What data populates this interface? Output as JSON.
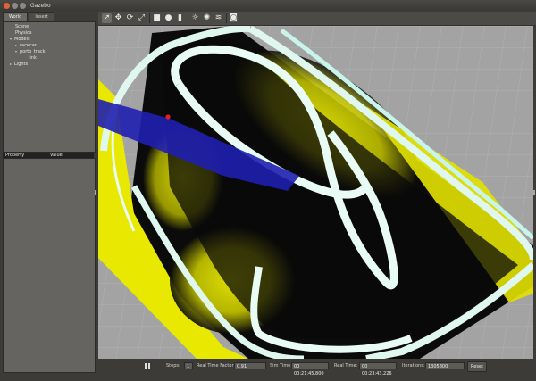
{
  "window": {
    "title": "Gazebo"
  },
  "tabs": [
    {
      "label": "World"
    },
    {
      "label": "Insert"
    }
  ],
  "tree": {
    "scene": "Scene",
    "physics": "Physics",
    "models": "Models",
    "racecar": "racecar",
    "track": "porto_track",
    "link": "link",
    "lights": "Lights"
  },
  "properties": {
    "col_property": "Property",
    "col_value": "Value"
  },
  "toolbar": {
    "icons": [
      "select-arrow-icon",
      "translate-icon",
      "rotate-icon",
      "scale-icon",
      "box-icon",
      "sphere-icon",
      "cylinder-icon",
      "sun-light-icon",
      "point-light-icon",
      "spot-light-icon",
      "camera-icon"
    ]
  },
  "status": {
    "steps_label": "Steps:",
    "steps_value": "1",
    "rtf_label": "Real Time Factor:",
    "rtf_value": "0.91",
    "sim_time_label": "Sim Time:",
    "sim_time_value": "00 00:21:45.800",
    "real_time_label": "Real Time:",
    "real_time_value": "00 00:23:43.226",
    "iterations_label": "Iterations:",
    "iterations_value": "1305800",
    "reset_label": "Reset"
  },
  "colors": {
    "track_yellow": "#f5f500",
    "track_black": "#0a0a0a",
    "wall": "#dff7ef",
    "laser": "#1f1fb0",
    "ground": "#a3a3a3"
  }
}
